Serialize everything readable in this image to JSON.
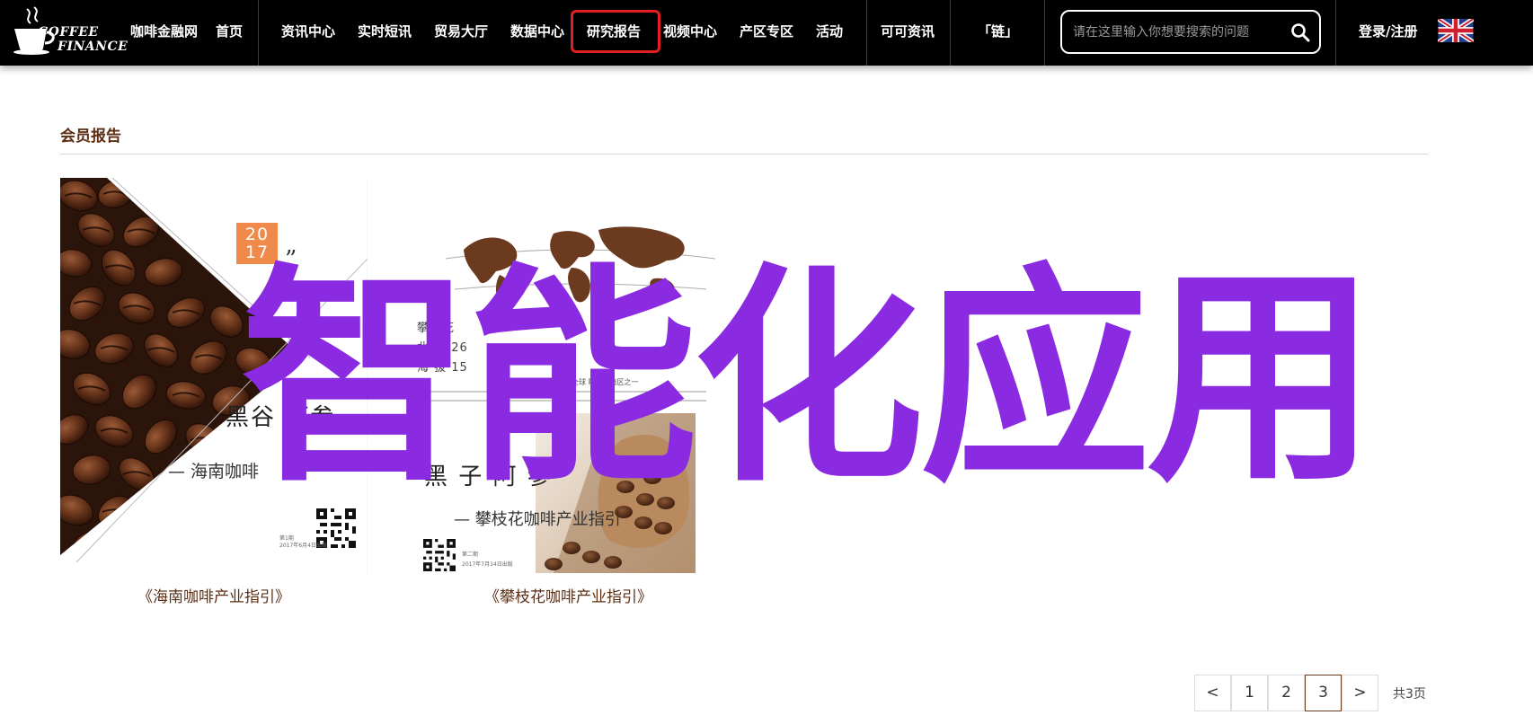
{
  "brand": {
    "logo_line1": "COFFEE",
    "logo_line2": "FINANCE"
  },
  "nav": {
    "site_name": "咖啡金融网",
    "home": "首页",
    "items": [
      "资讯中心",
      "实时短讯",
      "贸易大厅",
      "数据中心",
      "研究报告",
      "视频中心",
      "产区专区",
      "活动"
    ],
    "active_item": "研究报告",
    "keke": "可可资讯",
    "chain": "「链」",
    "login": "登录/注册",
    "language_flag": "uk-flag-icon"
  },
  "search": {
    "placeholder": "请在这里输入你想要搜索的问题",
    "icon": "search-icon"
  },
  "section": {
    "title": "会员报告"
  },
  "reports": [
    {
      "caption": "《海南咖啡产业指引》",
      "cover": {
        "year_top": "20",
        "year_bottom": "17",
        "quote": "”",
        "title": "黑谷  阿参",
        "subtitle": "— 海南咖啡",
        "qr_caption1": "第1期",
        "qr_caption2": "2017年6月4日出版"
      }
    },
    {
      "caption": "《攀枝花咖啡产业指引》",
      "cover": {
        "place": "攀枝花",
        "lat_label": "北 纬 26",
        "alt_label": "海 拔 15",
        "right_line1": "全  省咖啡产区",
        "right_line2": "全球  咖啡种植区之一",
        "title": "黑 子 阿 参",
        "subtitle": "— 攀枝花咖啡产业指引",
        "qr_caption1": "第二期",
        "qr_caption2": "2017年7月14日出版"
      }
    }
  ],
  "overlay": {
    "text": "智能化应用"
  },
  "pagination": {
    "prev": "<",
    "pages": [
      "1",
      "2",
      "3"
    ],
    "current": "3",
    "next": ">",
    "total": "共3页"
  },
  "colors": {
    "nav_bg": "#000000",
    "active_outline": "#e21f1f",
    "brown_text": "#5c2e14",
    "overlay_purple": "#8a2be2",
    "year_orange": "#f08a4b"
  }
}
